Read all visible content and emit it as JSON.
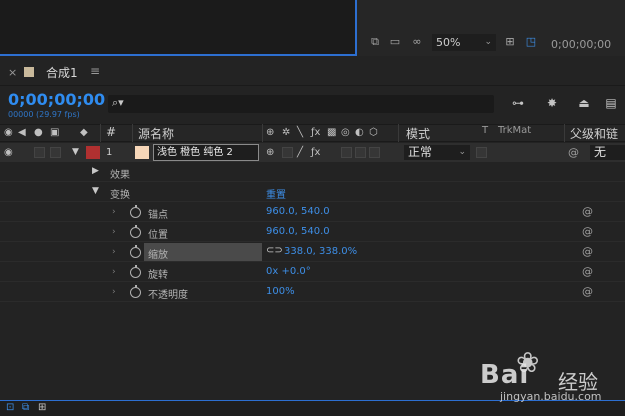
{
  "viewer": {
    "zoom": "50%",
    "timecode": "0;00;00;00",
    "icons": [
      "snapshot-icon",
      "monitor-icon",
      "mask-icon",
      "grid-icon",
      "region-icon"
    ]
  },
  "comp_tab": {
    "close": "×",
    "name": "合成1",
    "menu": "≡"
  },
  "timeline": {
    "timecode": "0;00;00;00",
    "fps": "00000 (29.97 fps)",
    "search_icon": "⌕▾"
  },
  "header": {
    "hash": "#",
    "source_name": "源名称",
    "mode": "模式",
    "t": "T",
    "trkmat": "TrkMat",
    "parent": "父级和链"
  },
  "layer": {
    "number": "1",
    "name": "浅色 橙色 纯色 2",
    "mode": "正常",
    "parent": "无",
    "label_color": "#b03030",
    "swatch_color": "#f6d6b8"
  },
  "groups": {
    "effects": "效果",
    "transform": "变换",
    "reset": "重置"
  },
  "properties": [
    {
      "name": "锚点",
      "value": "960.0, 540.0"
    },
    {
      "name": "位置",
      "value": "960.0, 540.0"
    },
    {
      "name": "缩放",
      "value": "338.0, 338.0%"
    },
    {
      "name": "旋转",
      "value": "0x +0.0°"
    },
    {
      "name": "不透明度",
      "value": "100%"
    }
  ],
  "watermark": {
    "brand": "Bai",
    "brand_suffix": "经验",
    "url": "jingyan.baidu.com"
  },
  "colors": {
    "accent": "#2f8cf0",
    "value_blue": "#3d8ee6",
    "panel": "#232323"
  }
}
